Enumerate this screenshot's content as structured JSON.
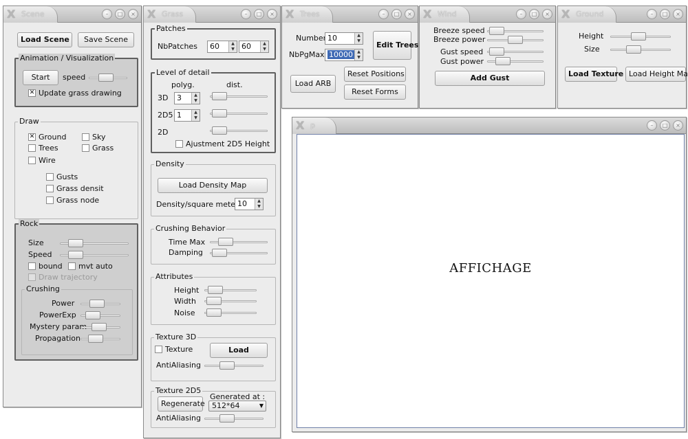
{
  "windows": {
    "scene": {
      "title": "Scene"
    },
    "grass": {
      "title": "Grass"
    },
    "trees": {
      "title": "Trees"
    },
    "wind": {
      "title": "Wind"
    },
    "ground": {
      "title": "Ground"
    },
    "p": {
      "title": "p"
    }
  },
  "scene": {
    "load_scene": "Load Scene",
    "save_scene": "Save Scene",
    "anim_group": "Animation / Visualization",
    "start": "Start",
    "speed": "speed",
    "update_grass": "Update grass drawing",
    "draw_group": "Draw",
    "ground": "Ground",
    "sky": "Sky",
    "trees": "Trees",
    "grass": "Grass",
    "wire": "Wire",
    "gusts": "Gusts",
    "grass_density": "Grass densit",
    "grass_node": "Grass node",
    "rock_group": "Rock",
    "size": "Size",
    "speed2": "Speed",
    "bound": "bound",
    "mvt_auto": "mvt auto",
    "draw_traj": "Draw trajectory",
    "crushing_group": "Crushing",
    "power": "Power",
    "powerexp": "PowerExp",
    "mystery": "Mystery param",
    "propagation": "Propagation"
  },
  "grass": {
    "patches_group": "Patches",
    "nbpatches": "NbPatches",
    "nbp1": "60",
    "nbp2": "60",
    "lod_group": "Level of detail",
    "polyg": "polyg.",
    "dist": "dist.",
    "l3d": "3D",
    "v3d": "3",
    "l2d5": "2D5",
    "v2d5": "1",
    "l2d": "2D",
    "adjust": "Ajustment 2D5 Height",
    "density_group": "Density",
    "load_density": "Load Density Map",
    "density_sq": "Density/square meters",
    "density_val": "10",
    "crushing_group": "Crushing Behavior",
    "timemax": "Time Max",
    "damping": "Damping",
    "attr_group": "Attributes",
    "height": "Height",
    "width": "Width",
    "noise": "Noise",
    "tex3d_group": "Texture 3D",
    "texture": "Texture",
    "load": "Load",
    "antialiasing": "AntiAliasing",
    "tex2d5_group": "Texture 2D5",
    "regenerate": "Regenerate",
    "generated_at": "Generated at :",
    "resolution": "512*64",
    "antialiasing2": "AntiAliasing"
  },
  "trees": {
    "number": "Number",
    "number_val": "10",
    "nbpgmax": "NbPgMax",
    "nbpgmax_val": "10000",
    "edit_trees": "Edit Trees",
    "load_arb": "Load ARB",
    "reset_positions": "Reset Positions",
    "reset_forms": "Reset Forms"
  },
  "wind": {
    "breeze_speed": "Breeze speed",
    "breeze_power": "Breeze power",
    "gust_speed": "Gust speed",
    "gust_power": "Gust power",
    "add_gust": "Add Gust"
  },
  "ground": {
    "height": "Height",
    "size": "Size",
    "load_texture": "Load Texture",
    "load_height_map": "Load Height Map"
  },
  "display": {
    "label": "AFFICHAGE"
  },
  "sliders": {
    "scene_speed": 0.4,
    "rock_size": 0.15,
    "rock_speed": 0.15,
    "power": 0.35,
    "powerexp": 0.2,
    "mystery": 0.45,
    "propagation": 0.3,
    "lod3d": 0.05,
    "lod2d5": 0.05,
    "lod2d": 0.05,
    "timemax": 0.2,
    "damping": 0.05,
    "height": 0.1,
    "width": 0.05,
    "noise": 0.05,
    "aa3d": 0.35,
    "aa2d5": 0.35,
    "breeze_speed": 0.05,
    "breeze_power": 0.5,
    "gust_speed": 0.05,
    "gust_power": 0.2,
    "ground_height": 0.45,
    "ground_size": 0.35
  }
}
